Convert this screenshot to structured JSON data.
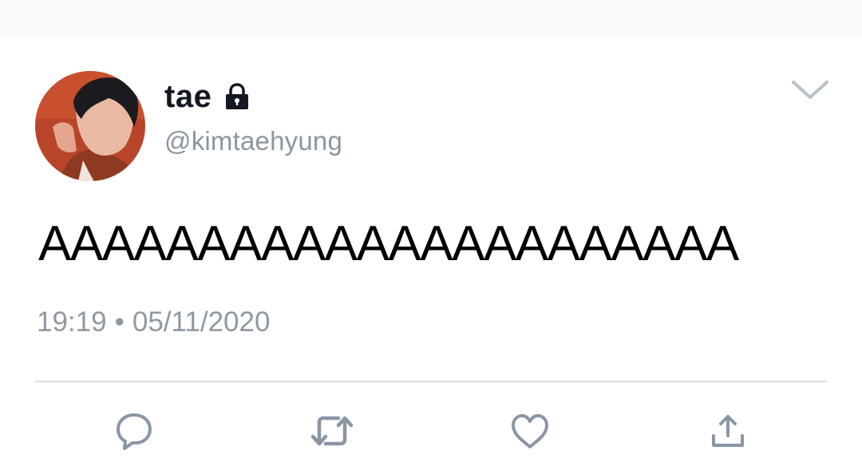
{
  "tweet": {
    "display_name": "tae",
    "handle": "@kimtaehyung",
    "text": "AAAAAAAAAAAAAAAAAAAAAA",
    "time": "19:19",
    "separator": "•",
    "date": "05/11/2020",
    "protected_icon": "lock-icon",
    "menu_icon": "chevron-down-icon"
  },
  "actions": [
    {
      "name": "reply",
      "icon": "reply-icon"
    },
    {
      "name": "retweet",
      "icon": "retweet-icon"
    },
    {
      "name": "like",
      "icon": "heart-icon"
    },
    {
      "name": "share",
      "icon": "share-icon"
    }
  ],
  "colors": {
    "text": "#141823",
    "secondary": "#8a96a0",
    "divider": "#d8dde2",
    "icon": "#8a96a6"
  }
}
